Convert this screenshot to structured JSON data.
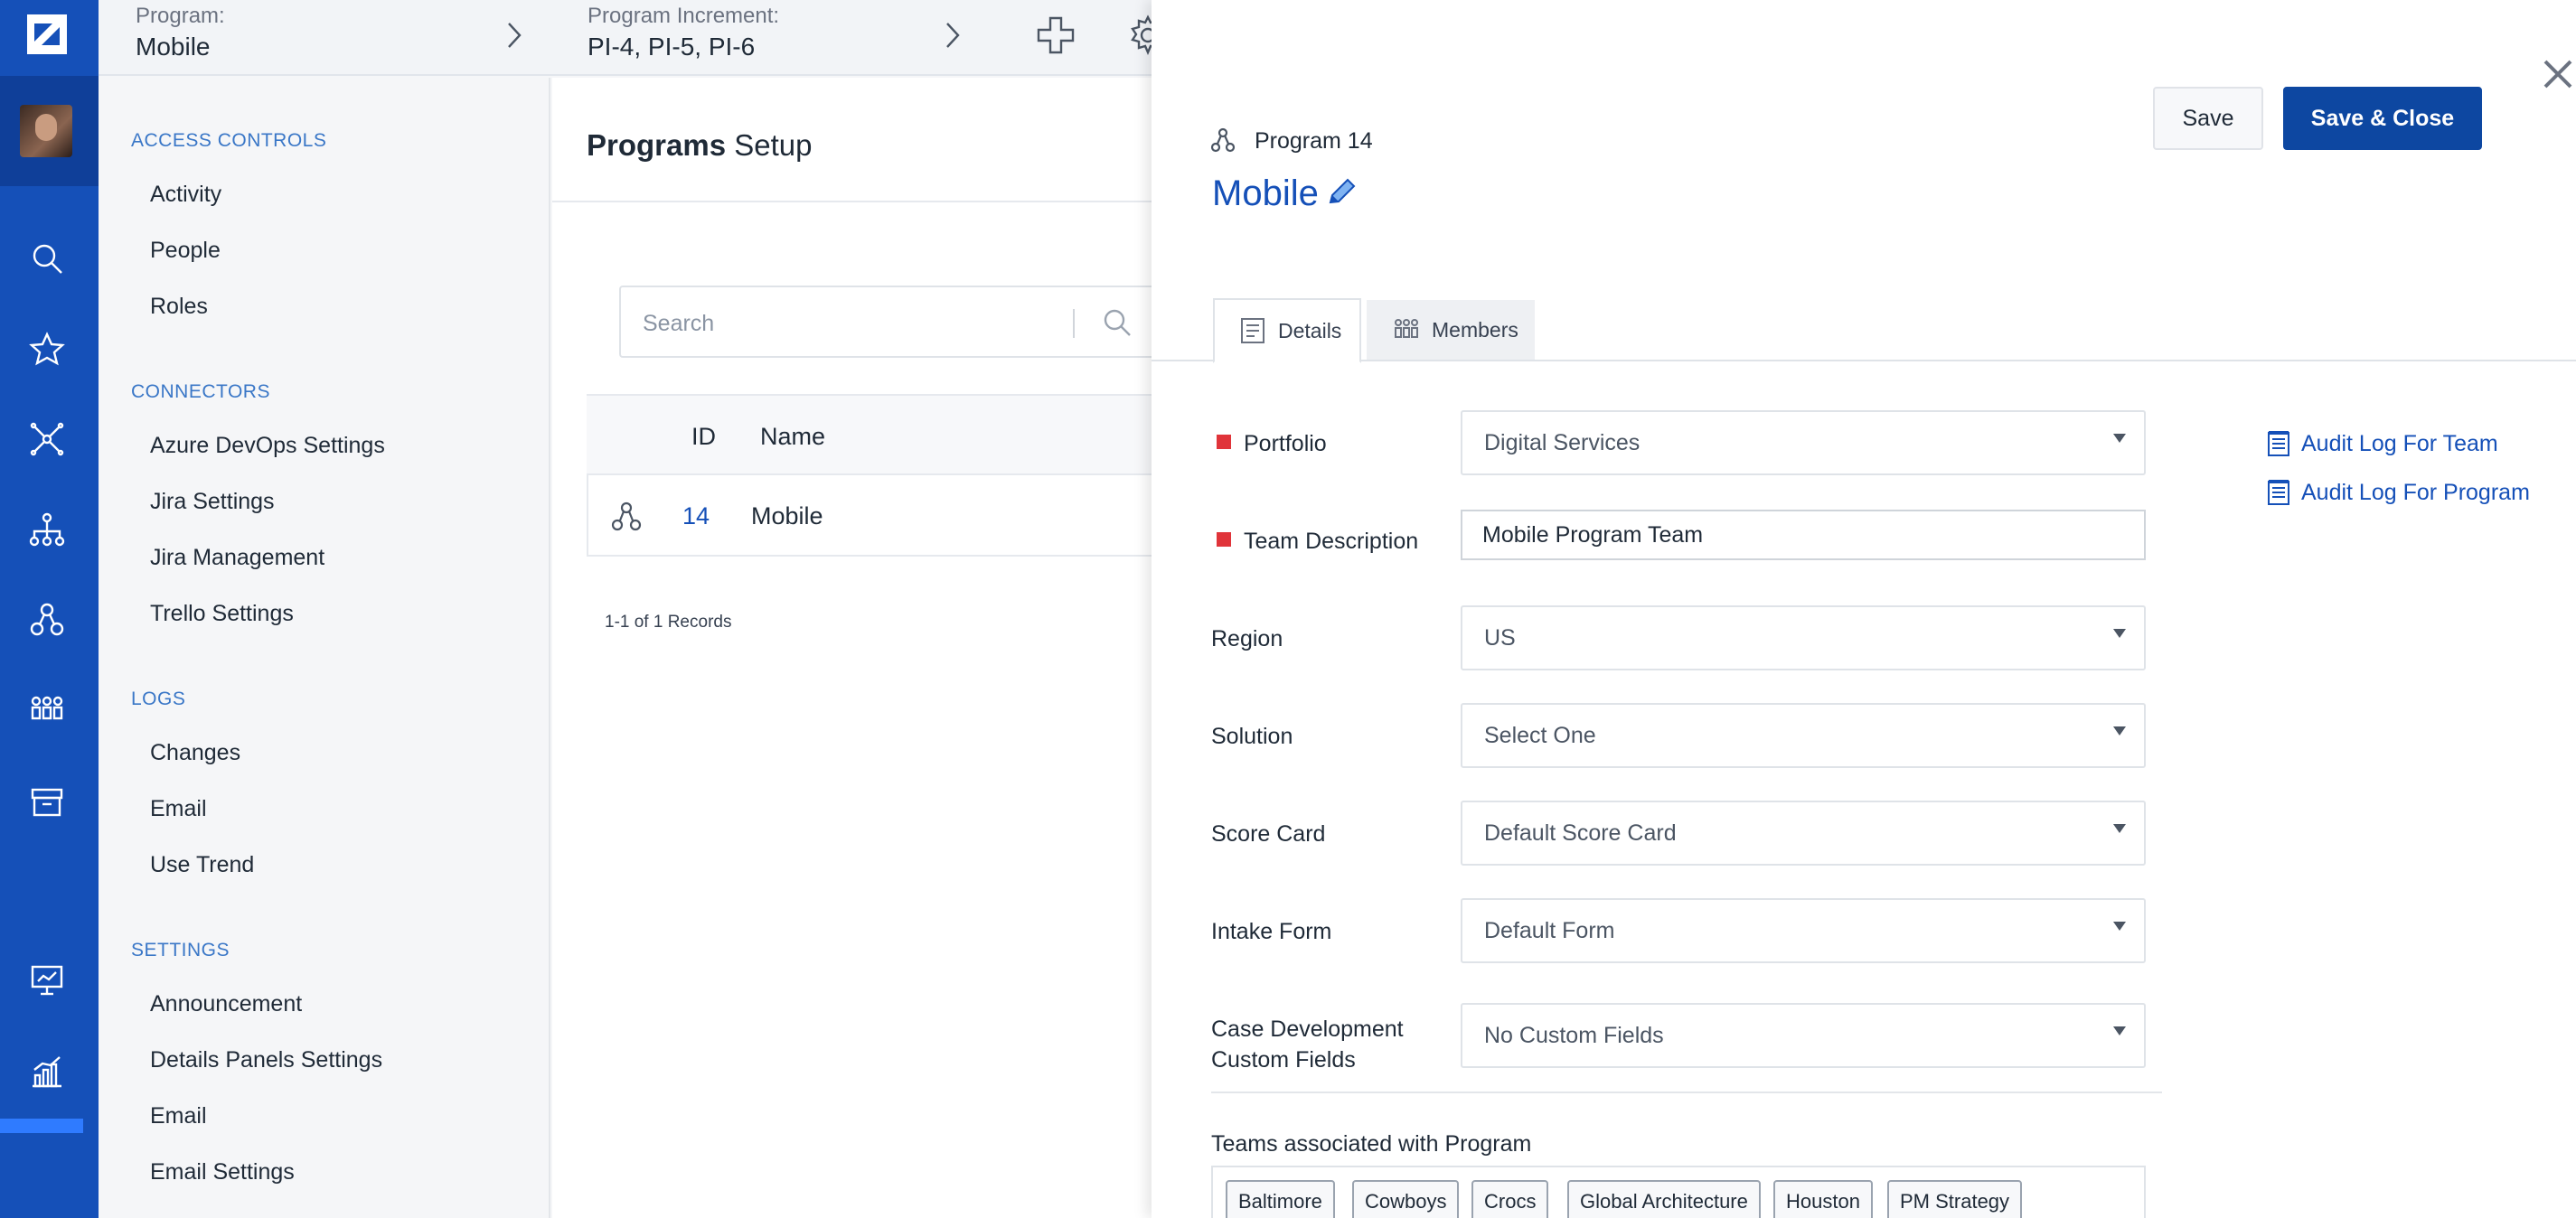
{
  "topbar": {
    "program_label": "Program:",
    "program_value": "Mobile",
    "increment_label": "Program Increment:",
    "increment_value": "PI-4, PI-5, PI-6"
  },
  "nav": {
    "access_controls": "ACCESS CONTROLS",
    "activity": "Activity",
    "people": "People",
    "roles": "Roles",
    "connectors": "CONNECTORS",
    "azure": "Azure DevOps Settings",
    "jira_settings": "Jira Settings",
    "jira_management": "Jira Management",
    "trello": "Trello Settings",
    "logs": "LOGS",
    "changes": "Changes",
    "email_log": "Email",
    "use_trend": "Use Trend",
    "settings": "SETTINGS",
    "announcement": "Announcement",
    "details_panels": "Details Panels Settings",
    "email_setting": "Email",
    "email_settings": "Email Settings"
  },
  "main": {
    "title_bold": "Programs",
    "title_rest": " Setup",
    "search_placeholder": "Search",
    "col_id": "ID",
    "col_name": "Name",
    "row_id": "14",
    "row_name": "Mobile",
    "records": "1-1 of 1 Records"
  },
  "panel": {
    "save": "Save",
    "save_close": "Save & Close",
    "subtitle": "Program 14",
    "title": "Mobile",
    "tab_details": "Details",
    "tab_members": "Members",
    "audit_team": "Audit Log For Team",
    "audit_program": "Audit Log For Program",
    "fields": {
      "portfolio_label": "Portfolio",
      "portfolio_value": "Digital Services",
      "team_desc_label": "Team Description",
      "team_desc_value": "Mobile Program Team",
      "region_label": "Region",
      "region_value": "US",
      "solution_label": "Solution",
      "solution_value": "Select One",
      "scorecard_label": "Score Card",
      "scorecard_value": "Default Score Card",
      "intake_label": "Intake Form",
      "intake_value": "Default Form",
      "case_dev_label_1": "Case Development",
      "case_dev_label_2": "Custom Fields",
      "case_dev_value": "No Custom Fields"
    },
    "teams_label": "Teams associated with Program",
    "teams": [
      "Baltimore",
      "Cowboys",
      "Crocs",
      "Global Architecture",
      "Houston",
      "PM Strategy"
    ]
  },
  "colors": {
    "rail": "#1550b8",
    "accent": "#0d47a1",
    "link": "#1550b8",
    "required": "#e0343a"
  }
}
